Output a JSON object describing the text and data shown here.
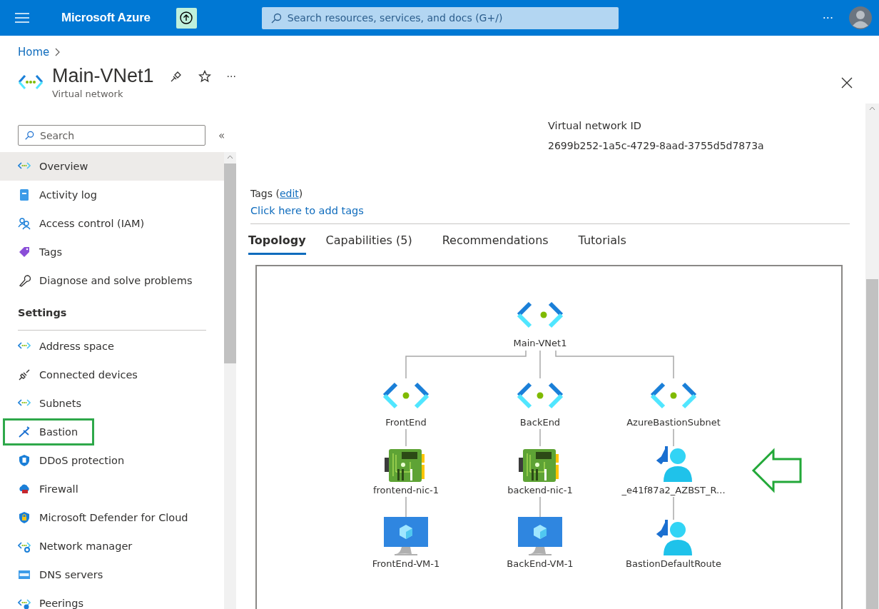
{
  "top_bar": {
    "product": "Microsoft Azure",
    "search": {
      "placeholder": "Search resources, services, and docs (G+/)"
    },
    "more": "···"
  },
  "breadcrumb": [
    {
      "label": "Home"
    }
  ],
  "resource": {
    "title": "Main-VNet1",
    "subtitle": "Virtual network",
    "more": "···"
  },
  "sidebar": {
    "search": {
      "placeholder": "Search"
    },
    "collapse": "«",
    "items": [
      {
        "kind": "item",
        "label": "Overview",
        "selected": true,
        "highlighted": false
      },
      {
        "kind": "item",
        "label": "Activity log",
        "selected": false,
        "highlighted": false
      },
      {
        "kind": "item",
        "label": "Access control (IAM)",
        "selected": false,
        "highlighted": false
      },
      {
        "kind": "item",
        "label": "Tags",
        "selected": false,
        "highlighted": false
      },
      {
        "kind": "item",
        "label": "Diagnose and solve problems",
        "selected": false,
        "highlighted": false
      },
      {
        "kind": "heading",
        "label": "Settings"
      },
      {
        "kind": "item",
        "label": "Address space",
        "selected": false,
        "highlighted": false
      },
      {
        "kind": "item",
        "label": "Connected devices",
        "selected": false,
        "highlighted": false
      },
      {
        "kind": "item",
        "label": "Subnets",
        "selected": false,
        "highlighted": false
      },
      {
        "kind": "item",
        "label": "Bastion",
        "selected": false,
        "highlighted": true
      },
      {
        "kind": "item",
        "label": "DDoS protection",
        "selected": false,
        "highlighted": false
      },
      {
        "kind": "item",
        "label": "Firewall",
        "selected": false,
        "highlighted": false
      },
      {
        "kind": "item",
        "label": "Microsoft Defender for Cloud",
        "selected": false,
        "highlighted": false
      },
      {
        "kind": "item",
        "label": "Network manager",
        "selected": false,
        "highlighted": false
      },
      {
        "kind": "item",
        "label": "DNS servers",
        "selected": false,
        "highlighted": false
      },
      {
        "kind": "item",
        "label": "Peerings",
        "selected": false,
        "highlighted": false
      }
    ]
  },
  "essentials": {
    "label": "Virtual network ID",
    "value": "2699b252-1a5c-4729-8aad-3755d5d7873a"
  },
  "tags": {
    "label": "Tags (",
    "edit": "edit",
    "label_end": ")",
    "add_link": "Click here to add tags"
  },
  "tabs": [
    {
      "label": "Topology",
      "selected": true
    },
    {
      "label": "Capabilities (5)",
      "selected": false
    },
    {
      "label": "Recommendations",
      "selected": false
    },
    {
      "label": "Tutorials",
      "selected": false
    }
  ],
  "topology": {
    "kind": "vnet",
    "label": "Main-VNet1",
    "children": [
      {
        "kind": "subnet",
        "label": "FrontEnd",
        "children": [
          {
            "kind": "nic",
            "label": "frontend-nic-1",
            "children": [
              {
                "kind": "vm",
                "label": "FrontEnd-VM-1"
              }
            ]
          }
        ]
      },
      {
        "kind": "subnet",
        "label": "BackEnd",
        "children": [
          {
            "kind": "nic",
            "label": "backend-nic-1",
            "children": [
              {
                "kind": "vm",
                "label": "BackEnd-VM-1"
              }
            ]
          }
        ]
      },
      {
        "kind": "subnet",
        "label": "AzureBastionSubnet",
        "children": [
          {
            "kind": "user",
            "label": "_e41f87a2_AZBST_R...",
            "callout": true,
            "children": [
              {
                "kind": "user",
                "label": "BastionDefaultRoute",
                "callout": false
              }
            ]
          }
        ]
      }
    ]
  }
}
